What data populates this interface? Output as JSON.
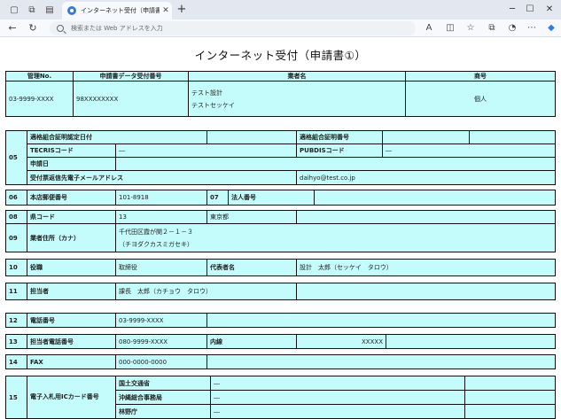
{
  "browser": {
    "tab_title": "インターネット受付（申請書①）",
    "address_placeholder": "検索または Web アドレスを入力"
  },
  "page": {
    "title": "インターネット受付（申請書①）"
  },
  "header_table": {
    "headers": [
      "管理No.",
      "申請書データ受付番号",
      "業者名",
      "商号"
    ],
    "kanri_no": "03-9999-XXXX",
    "uketsuke_no": "98XXXXXXXX",
    "gyosha_name_1": "テスト設計",
    "gyosha_name_2": "テストセッケイ",
    "shogo": "個人"
  },
  "form": {
    "s05": {
      "num": "05",
      "l1": "適格組合証明認定日付",
      "l2": "適格組合証明番号",
      "tecris_label": "TECRISコード",
      "tecris_value": "―",
      "pubdis_label": "PUBDISコード",
      "pubdis_value": "―",
      "shinsei_label": "申請日",
      "mail_label": "受付票返信先電子メールアドレス",
      "mail_value": "daihyo@test.co.jp"
    },
    "s06": {
      "num": "06",
      "label": "本店郵便番号",
      "value": "101-8918"
    },
    "s07": {
      "num": "07",
      "label": "法人番号"
    },
    "s08": {
      "num": "08",
      "label": "県コード",
      "value": "13",
      "pref": "東京都"
    },
    "s09": {
      "num": "09",
      "label": "業者住所（カナ）",
      "address": "千代田区霞が関２－１－３",
      "address_kana": "（チヨダクカスミガセキ）"
    },
    "s10": {
      "num": "10",
      "label": "役職",
      "value": "取締役",
      "rep_label": "代表者名",
      "rep_value": "設計　太郎（セッケイ　タロウ）"
    },
    "s11": {
      "num": "11",
      "label": "担当者",
      "value": "課長　太郎（カチョウ　タロウ）"
    },
    "s12": {
      "num": "12",
      "label": "電話番号",
      "value": "03-9999-XXXX"
    },
    "s13": {
      "num": "13",
      "label": "担当者電話番号",
      "value": "080-9999-XXXX",
      "ext_label": "内線",
      "ext_value": "XXXXX"
    },
    "s14": {
      "num": "14",
      "label": "FAX",
      "value": "000-0000-0000"
    },
    "s15": {
      "num": "15",
      "label": "電子入札用ICカード番号",
      "orgs": [
        {
          "name": "国土交通省",
          "value": "―"
        },
        {
          "name": "沖縄総合事務局",
          "value": "―"
        },
        {
          "name": "林野庁",
          "value": "―"
        }
      ]
    }
  }
}
